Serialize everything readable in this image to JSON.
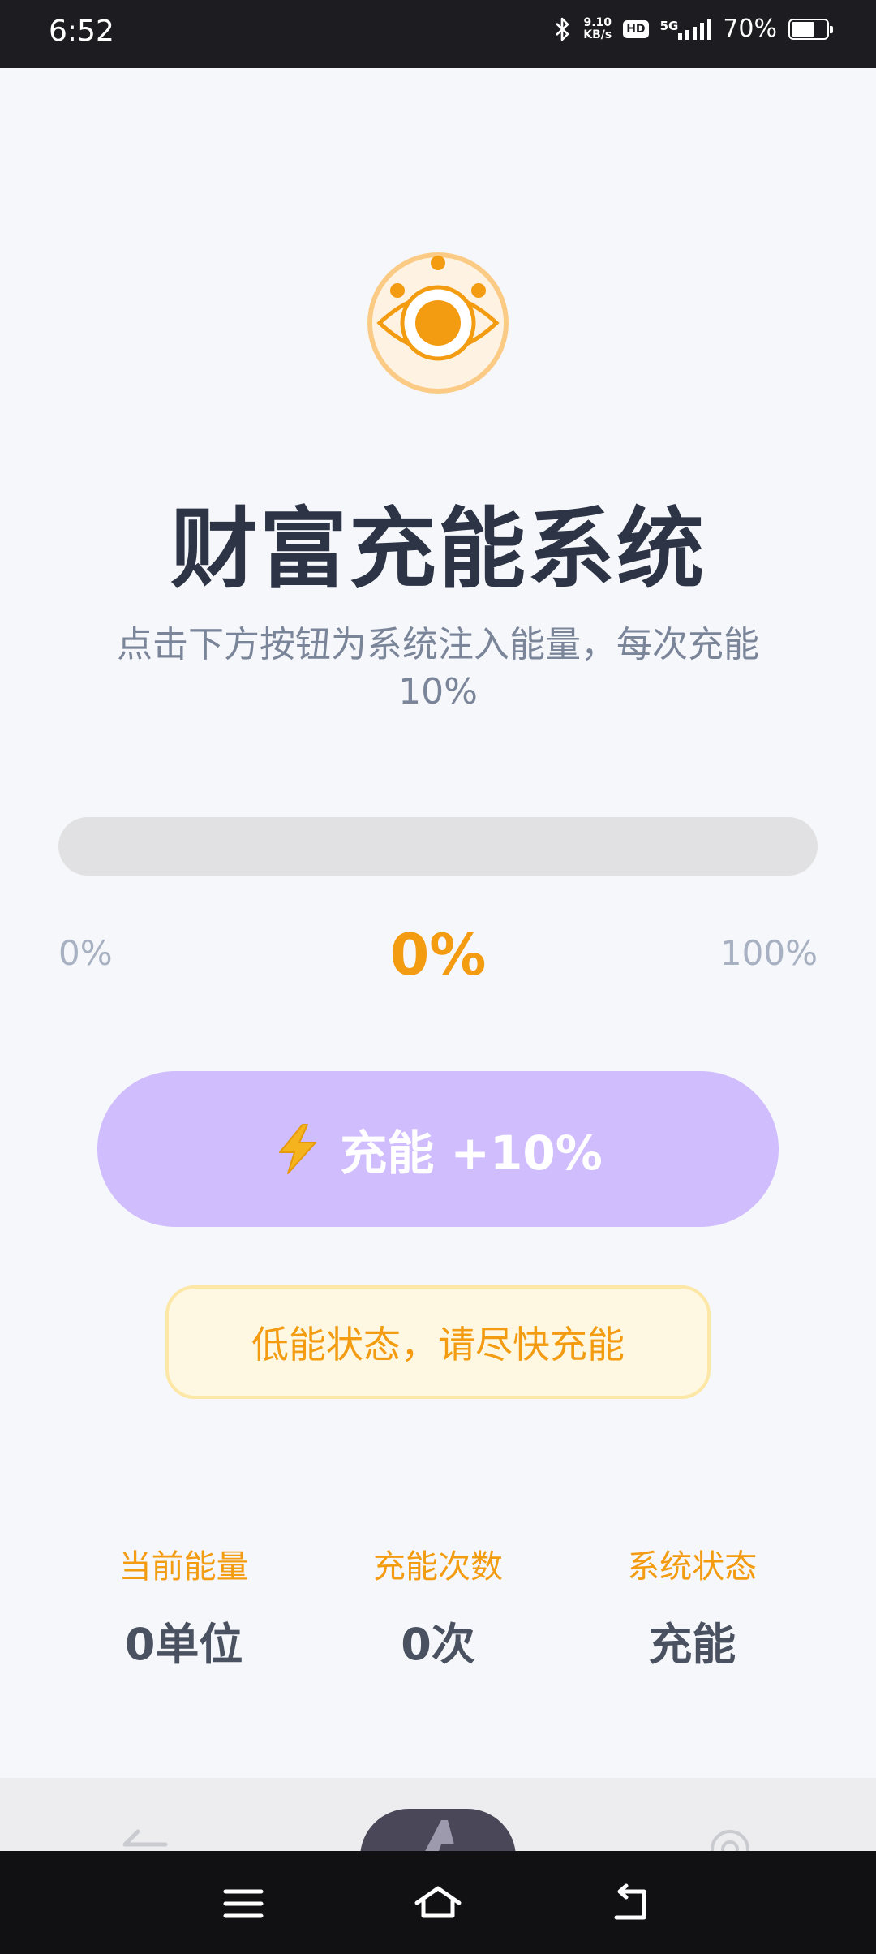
{
  "status_bar": {
    "time": "6:52",
    "net_speed_value": "9.10",
    "net_speed_unit": "KB/s",
    "hd_label": "HD",
    "network_type": "5G",
    "battery_text": "70%",
    "battery_level": 0.7
  },
  "header": {
    "logo_icon": "eye-icon",
    "title": "财富充能系统",
    "subtitle": "点击下方按钮为系统注入能量，每次充能10%"
  },
  "progress": {
    "value": 0,
    "min_label": "0%",
    "current_label": "0%",
    "max_label": "100%"
  },
  "charge_button": {
    "icon": "lightning-icon",
    "label": "充能 +10%"
  },
  "status_message": "低能状态，请尽快充能",
  "stats": [
    {
      "label": "当前能量",
      "value": "0单位"
    },
    {
      "label": "充能次数",
      "value": "0次"
    },
    {
      "label": "系统状态",
      "value": "充能"
    }
  ],
  "colors": {
    "accent": "#F39C12",
    "button": "#D0BDFE",
    "title": "#2C3445",
    "background": "#F6F7FA"
  }
}
